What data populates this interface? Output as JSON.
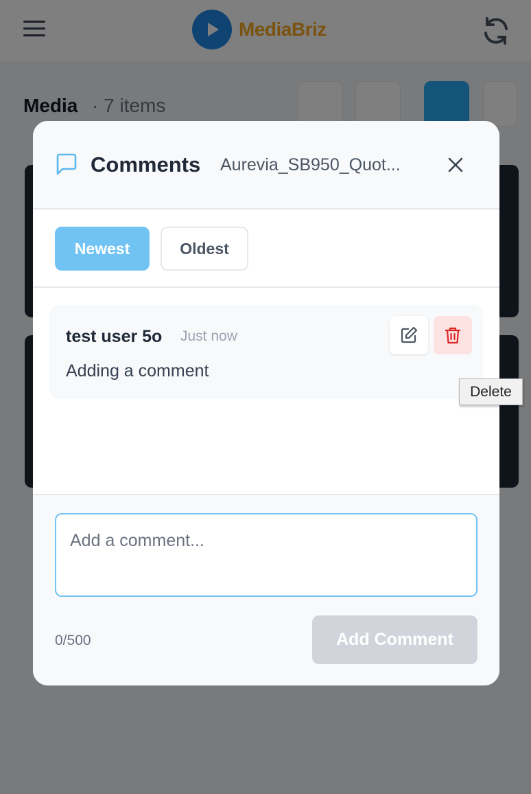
{
  "app": {
    "brand": "MediaBriz",
    "media_title": "Media",
    "media_count": "· 7 items"
  },
  "modal": {
    "title": "Comments",
    "file_name": "Aurevia_SB950_Quot...",
    "sort": {
      "newest_label": "Newest",
      "oldest_label": "Oldest",
      "selected": "Newest"
    },
    "comments": [
      {
        "author": "test user 5o",
        "time": "Just now",
        "text": "Adding a comment"
      }
    ],
    "composer": {
      "placeholder": "Add a comment...",
      "value": "",
      "char_count": "0/500",
      "submit_label": "Add Comment"
    }
  },
  "tooltip": {
    "text": "Delete"
  },
  "colors": {
    "accent": "#70c3f3",
    "delete_bg": "#fde2e2",
    "delete_icon": "#dc2626",
    "brand_orange": "#f5a623",
    "brand_blue": "#1e88e5"
  },
  "icons": {
    "header_left": "hamburger-menu-icon",
    "header_right": "refresh-icon",
    "modal_title": "chat-bubble-icon",
    "close": "close-icon",
    "edit": "edit-pencil-icon",
    "delete": "trash-icon"
  }
}
